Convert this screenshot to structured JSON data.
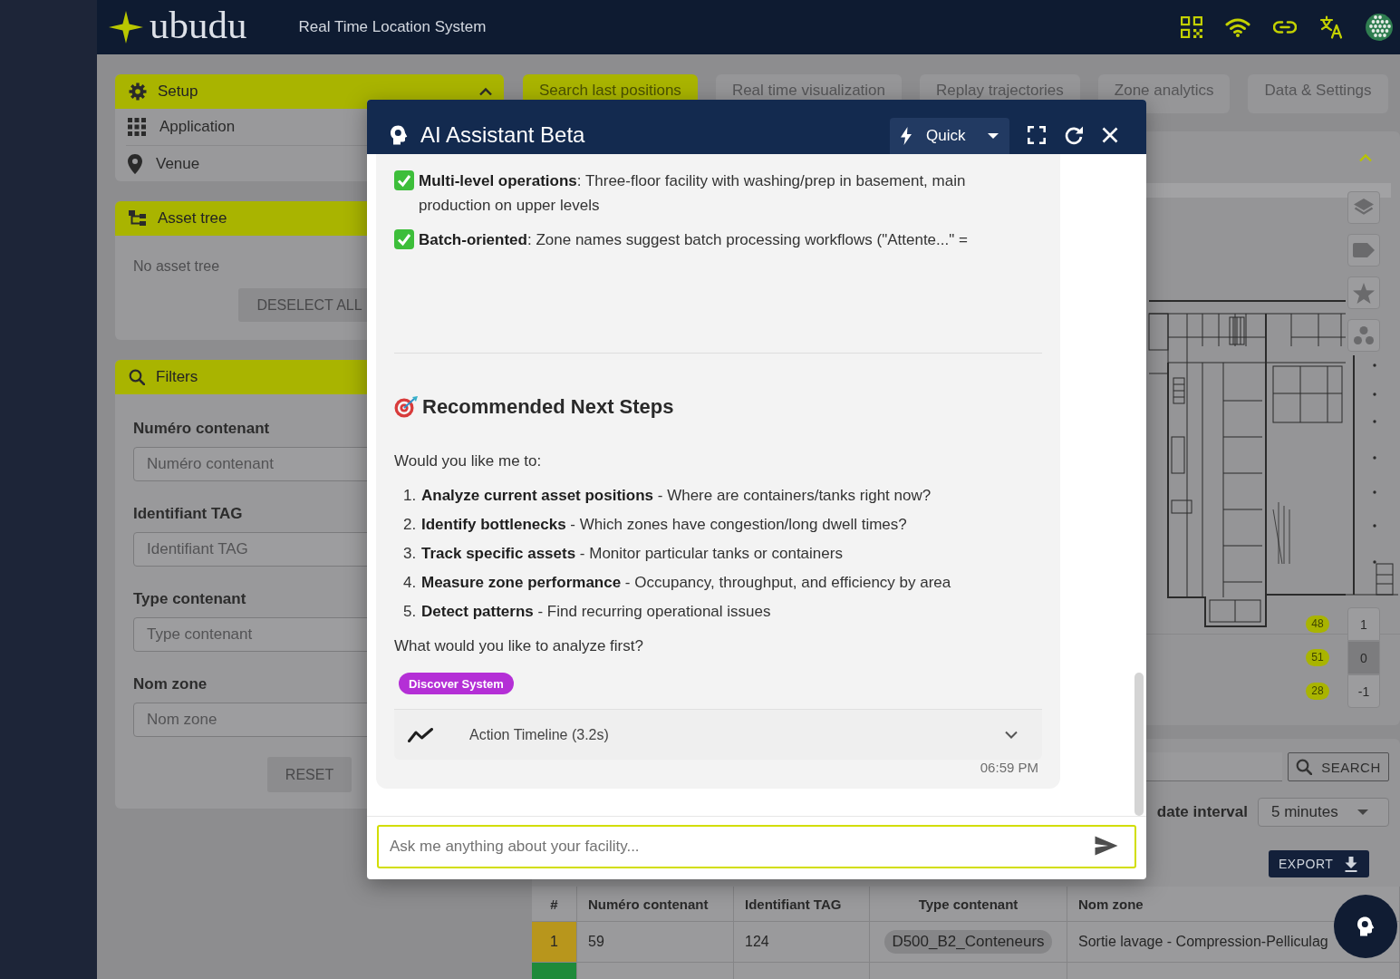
{
  "header": {
    "brand": "ubudu",
    "subtitle": "Real Time Location System"
  },
  "sidebar": {
    "setup": {
      "title": "Setup",
      "expanded": true,
      "items": [
        {
          "label": "Application",
          "kind": "application"
        },
        {
          "label": "Venue",
          "kind": "venue"
        }
      ]
    },
    "asset_tree": {
      "title": "Asset tree",
      "empty_text": "No asset tree",
      "button": {
        "label": "DESELECT ALL",
        "disabled": true
      }
    },
    "filters": {
      "title": "Filters",
      "fields": [
        {
          "label": "Numéro contenant",
          "placeholder": "Numéro contenant"
        },
        {
          "label": "Identifiant TAG",
          "placeholder": "Identifiant TAG"
        },
        {
          "label": "Type contenant",
          "placeholder": "Type contenant"
        },
        {
          "label": "Nom zone",
          "placeholder": "Nom zone"
        }
      ],
      "button": {
        "label": "RESET",
        "disabled": true
      }
    }
  },
  "tabs": [
    {
      "label": "Search last positions",
      "selected": true
    },
    {
      "label": "Real time visualization",
      "selected": false
    },
    {
      "label": "Replay trajectories",
      "selected": false
    },
    {
      "label": "Zone analytics",
      "selected": false
    },
    {
      "label": "Data & Settings",
      "selected": false
    }
  ],
  "map": {
    "expanded": true,
    "floors": [
      {
        "label": "1",
        "count": "48",
        "selected": false
      },
      {
        "label": "0",
        "count": "51",
        "selected": true
      },
      {
        "label": "-1",
        "count": "28",
        "selected": false
      }
    ]
  },
  "results": {
    "search_button": "SEARCH",
    "interval": {
      "label": "date interval",
      "value": "5 minutes"
    },
    "export_button": "EXPORT"
  },
  "table": {
    "columns": [
      {
        "label": "#",
        "kind": "index"
      },
      {
        "label": "Numéro contenant",
        "kind": "text"
      },
      {
        "label": "Identifiant TAG",
        "kind": "text"
      },
      {
        "label": "Type contenant",
        "kind": "chip"
      },
      {
        "label": "Nom zone",
        "kind": "text"
      }
    ],
    "rows": [
      {
        "color": "#b8961c",
        "cells": [
          "1",
          "59",
          "124",
          "D500_B2_Conteneurs",
          "Sortie lavage - Compression-Pelliculag"
        ]
      },
      {
        "color": "#1e8a3a"
      }
    ]
  },
  "assistant": {
    "title": "AI Assistant Beta",
    "mode": "Quick",
    "highlights": [
      {
        "text": "**Multi-level operations**: Three-floor facility with washing/prep in basement, main production on upper levels"
      },
      {
        "text": "**Batch-oriented**: Zone names suggest batch processing workflows (\"Attente...\" ="
      }
    ],
    "heading": "Recommended Next Steps",
    "intro": "Would you like me to:",
    "steps": [
      {
        "number": "1.",
        "text": "**Analyze current asset positions** - Where are containers/tanks right now?"
      },
      {
        "number": "2.",
        "text": "**Identify bottlenecks** - Which zones have congestion/long dwell times?"
      },
      {
        "number": "3.",
        "text": "**Track specific assets** - Monitor particular tanks or containers"
      },
      {
        "number": "4.",
        "text": "**Measure zone performance** - Occupancy, throughput, and efficiency by area"
      },
      {
        "number": "5.",
        "text": "**Detect patterns** - Find recurring operational issues"
      }
    ],
    "question": "What would you like to analyze first?",
    "tags": [
      "Discover System"
    ],
    "timeline": {
      "label": "Action Timeline (3.2s)",
      "expanded": false
    },
    "time": "06:59 PM",
    "input": {
      "placeholder": "Ask me anything about your facility..."
    }
  }
}
